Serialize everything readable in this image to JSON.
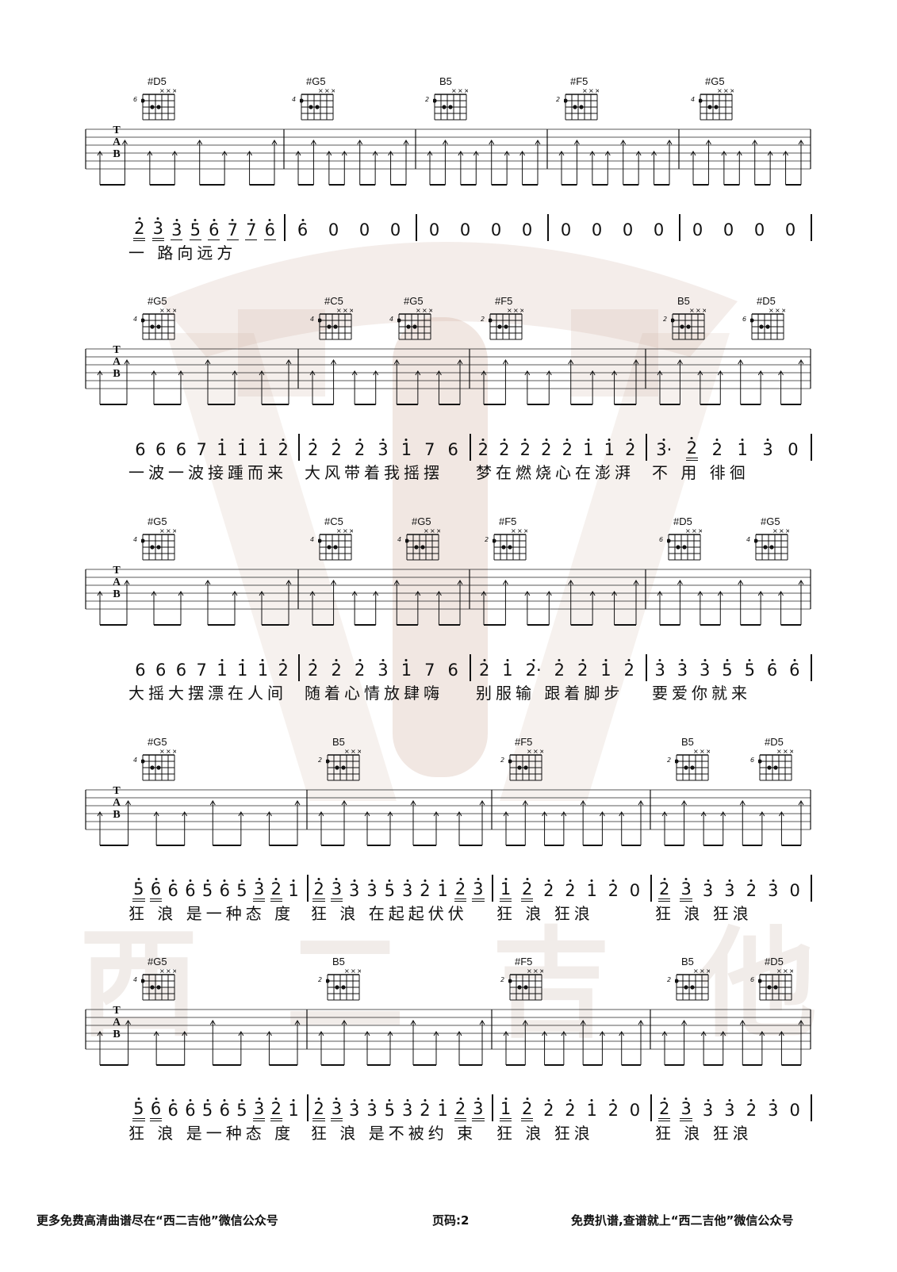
{
  "watermark": {
    "text": "西二吉他"
  },
  "systems": [
    {
      "chords": [
        {
          "name": "#D5",
          "fret": "6"
        },
        {
          "name": "#G5",
          "fret": "4"
        },
        {
          "name": "B5",
          "fret": "2"
        },
        {
          "name": "#F5",
          "fret": "2"
        },
        {
          "name": "#G5",
          "fret": "4"
        }
      ],
      "bars": [
        {
          "notes": [
            {
              "t": "2",
              "u": 2,
              "d": "hd"
            },
            {
              "t": "3",
              "u": 2,
              "d": "hd"
            },
            {
              "t": "3",
              "u": 1,
              "d": "hd"
            },
            {
              "t": "5",
              "u": 1,
              "d": "hd"
            },
            {
              "t": "6",
              "u": 1,
              "d": "hd"
            },
            {
              "t": "7",
              "u": 1,
              "d": "hd"
            },
            {
              "t": "7",
              "u": 1,
              "d": "hd"
            },
            {
              "t": "6",
              "u": 1,
              "d": "hd"
            }
          ]
        },
        {
          "notes": [
            {
              "t": "6",
              "u": 0,
              "d": "hd"
            },
            {
              "t": "0"
            },
            {
              "t": "0"
            },
            {
              "t": "0"
            }
          ]
        },
        {
          "notes": [
            {
              "t": "0"
            },
            {
              "t": "0"
            },
            {
              "t": "0"
            },
            {
              "t": "0"
            }
          ]
        },
        {
          "notes": [
            {
              "t": "0"
            },
            {
              "t": "0"
            },
            {
              "t": "0"
            },
            {
              "t": "0"
            }
          ]
        },
        {
          "notes": [
            {
              "t": "0"
            },
            {
              "t": "0"
            },
            {
              "t": "0"
            },
            {
              "t": "0"
            }
          ]
        }
      ],
      "lyrics": [
        "一 路向远方"
      ]
    },
    {
      "chords": [
        {
          "name": "#G5",
          "fret": "4"
        },
        {
          "name": "#C5",
          "fret": "4"
        },
        {
          "name": "#G5",
          "fret": "4"
        },
        {
          "name": "#F5",
          "fret": "2"
        },
        {
          "name": "B5",
          "fret": "2"
        },
        {
          "name": "#D5",
          "fret": "6"
        }
      ],
      "bars": [
        {
          "notes": [
            {
              "t": "6"
            },
            {
              "t": "6"
            },
            {
              "t": "6"
            },
            {
              "t": "7"
            },
            {
              "t": "1",
              "d": "hd"
            },
            {
              "t": "1",
              "d": "hd"
            },
            {
              "t": "1",
              "d": "hd"
            },
            {
              "t": "2",
              "d": "hd"
            }
          ]
        },
        {
          "notes": [
            {
              "t": "2",
              "d": "hd"
            },
            {
              "t": "2",
              "d": "hd"
            },
            {
              "t": "2",
              "d": "hd"
            },
            {
              "t": "3",
              "d": "hd"
            },
            {
              "t": "1",
              "d": "hd"
            },
            {
              "t": "7"
            },
            {
              "t": "6"
            }
          ]
        },
        {
          "notes": [
            {
              "t": "2",
              "d": "hd"
            },
            {
              "t": "2",
              "d": "hd"
            },
            {
              "t": "2",
              "d": "hd"
            },
            {
              "t": "2",
              "d": "hd"
            },
            {
              "t": "2",
              "d": "hd"
            },
            {
              "t": "1",
              "d": "hd"
            },
            {
              "t": "1",
              "d": "hd"
            },
            {
              "t": "2",
              "d": "hd"
            }
          ]
        },
        {
          "notes": [
            {
              "t": "3·",
              "d": "hd"
            },
            {
              "t": "2",
              "d": "hd",
              "u": 2
            },
            {
              "t": "2",
              "d": "hd"
            },
            {
              "t": "1",
              "d": "hd"
            },
            {
              "t": "3",
              "d": "hd"
            },
            {
              "t": "0"
            }
          ]
        }
      ],
      "lyrics": [
        "一波一波接踵而来",
        "大风带着我摇摆",
        "梦在燃烧心在澎湃",
        "不 用 徘徊"
      ]
    },
    {
      "chords": [
        {
          "name": "#G5",
          "fret": "4"
        },
        {
          "name": "#C5",
          "fret": "4"
        },
        {
          "name": "#G5",
          "fret": "4"
        },
        {
          "name": "#F5",
          "fret": "2"
        },
        {
          "name": "#D5",
          "fret": "6"
        },
        {
          "name": "#G5",
          "fret": "4"
        }
      ],
      "bars": [
        {
          "notes": [
            {
              "t": "6"
            },
            {
              "t": "6"
            },
            {
              "t": "6"
            },
            {
              "t": "7"
            },
            {
              "t": "1",
              "d": "hd"
            },
            {
              "t": "1",
              "d": "hd"
            },
            {
              "t": "1",
              "d": "hd"
            },
            {
              "t": "2",
              "d": "hd"
            }
          ]
        },
        {
          "notes": [
            {
              "t": "2",
              "d": "hd"
            },
            {
              "t": "2",
              "d": "hd"
            },
            {
              "t": "2",
              "d": "hd"
            },
            {
              "t": "3",
              "d": "hd"
            },
            {
              "t": "1",
              "d": "hd"
            },
            {
              "t": "7"
            },
            {
              "t": "6"
            }
          ]
        },
        {
          "notes": [
            {
              "t": "2",
              "d": "hd"
            },
            {
              "t": "1",
              "d": "hd"
            },
            {
              "t": "2·",
              "d": "hd"
            },
            {
              "t": "2",
              "d": "hd"
            },
            {
              "t": "2",
              "d": "hd"
            },
            {
              "t": "1",
              "d": "hd"
            },
            {
              "t": "2",
              "d": "hd"
            }
          ]
        },
        {
          "notes": [
            {
              "t": "3",
              "d": "hd"
            },
            {
              "t": "3",
              "d": "hd"
            },
            {
              "t": "3",
              "d": "hd"
            },
            {
              "t": "5",
              "d": "hd"
            },
            {
              "t": "5",
              "d": "hd"
            },
            {
              "t": "6",
              "d": "hd"
            },
            {
              "t": "6",
              "d": "hd"
            }
          ]
        }
      ],
      "lyrics": [
        "大摇大摆漂在人间",
        "随着心情放肆嗨",
        "别服输 跟着脚步",
        "要爱你就来"
      ]
    },
    {
      "chords": [
        {
          "name": "#G5",
          "fret": "4"
        },
        {
          "name": "B5",
          "fret": "2"
        },
        {
          "name": "#F5",
          "fret": "2"
        },
        {
          "name": "B5",
          "fret": "2"
        },
        {
          "name": "#D5",
          "fret": "6"
        }
      ],
      "bars": [
        {
          "notes": [
            {
              "t": "5",
              "d": "hd",
              "u": 2
            },
            {
              "t": "6",
              "d": "hd",
              "u": 2
            },
            {
              "t": "6",
              "d": "hd"
            },
            {
              "t": "6",
              "d": "hd"
            },
            {
              "t": "5",
              "d": "hd"
            },
            {
              "t": "6",
              "d": "hd"
            },
            {
              "t": "5",
              "d": "hd"
            },
            {
              "t": "3",
              "d": "hd",
              "u": 2
            },
            {
              "t": "2",
              "d": "hd",
              "u": 2
            },
            {
              "t": "1",
              "d": "hd"
            }
          ]
        },
        {
          "notes": [
            {
              "t": "2",
              "d": "hd",
              "u": 2
            },
            {
              "t": "3",
              "d": "hd",
              "u": 2
            },
            {
              "t": "3",
              "d": "hd"
            },
            {
              "t": "3",
              "d": "hd"
            },
            {
              "t": "5",
              "d": "hd"
            },
            {
              "t": "3",
              "d": "hd"
            },
            {
              "t": "2",
              "d": "hd"
            },
            {
              "t": "1",
              "d": "hd"
            },
            {
              "t": "2",
              "d": "hd",
              "u": 2
            },
            {
              "t": "3",
              "d": "hd",
              "u": 2
            }
          ]
        },
        {
          "notes": [
            {
              "t": "1",
              "d": "hd",
              "u": 2
            },
            {
              "t": "2",
              "d": "hd",
              "u": 2
            },
            {
              "t": "2",
              "d": "hd"
            },
            {
              "t": "2",
              "d": "hd"
            },
            {
              "t": "1",
              "d": "hd"
            },
            {
              "t": "2",
              "d": "hd"
            },
            {
              "t": "0"
            }
          ]
        },
        {
          "notes": [
            {
              "t": "2",
              "d": "hd",
              "u": 2
            },
            {
              "t": "3",
              "d": "hd",
              "u": 2
            },
            {
              "t": "3",
              "d": "hd"
            },
            {
              "t": "3",
              "d": "hd"
            },
            {
              "t": "2",
              "d": "hd"
            },
            {
              "t": "3",
              "d": "hd"
            },
            {
              "t": "0"
            }
          ]
        }
      ],
      "lyrics": [
        "狂 浪  是一种态 度",
        "狂 浪  在起起伏伏",
        "狂 浪  狂浪",
        "狂 浪  狂浪"
      ]
    },
    {
      "chords": [
        {
          "name": "#G5",
          "fret": "4"
        },
        {
          "name": "B5",
          "fret": "2"
        },
        {
          "name": "#F5",
          "fret": "2"
        },
        {
          "name": "B5",
          "fret": "2"
        },
        {
          "name": "#D5",
          "fret": "6"
        }
      ],
      "bars": [
        {
          "notes": [
            {
              "t": "5",
              "d": "hd",
              "u": 2
            },
            {
              "t": "6",
              "d": "hd",
              "u": 2
            },
            {
              "t": "6",
              "d": "hd"
            },
            {
              "t": "6",
              "d": "hd"
            },
            {
              "t": "5",
              "d": "hd"
            },
            {
              "t": "6",
              "d": "hd"
            },
            {
              "t": "5",
              "d": "hd"
            },
            {
              "t": "3",
              "d": "hd",
              "u": 2
            },
            {
              "t": "2",
              "d": "hd",
              "u": 2
            },
            {
              "t": "1",
              "d": "hd"
            }
          ]
        },
        {
          "notes": [
            {
              "t": "2",
              "d": "hd",
              "u": 2
            },
            {
              "t": "3",
              "d": "hd",
              "u": 2
            },
            {
              "t": "3",
              "d": "hd"
            },
            {
              "t": "3",
              "d": "hd"
            },
            {
              "t": "5",
              "d": "hd"
            },
            {
              "t": "3",
              "d": "hd"
            },
            {
              "t": "2",
              "d": "hd"
            },
            {
              "t": "1",
              "d": "hd"
            },
            {
              "t": "2",
              "d": "hd",
              "u": 2
            },
            {
              "t": "3",
              "d": "hd",
              "u": 2
            }
          ]
        },
        {
          "notes": [
            {
              "t": "1",
              "d": "hd",
              "u": 2
            },
            {
              "t": "2",
              "d": "hd",
              "u": 2
            },
            {
              "t": "2",
              "d": "hd"
            },
            {
              "t": "2",
              "d": "hd"
            },
            {
              "t": "1",
              "d": "hd"
            },
            {
              "t": "2",
              "d": "hd"
            },
            {
              "t": "0"
            }
          ]
        },
        {
          "notes": [
            {
              "t": "2",
              "d": "hd",
              "u": 2
            },
            {
              "t": "3",
              "d": "hd",
              "u": 2
            },
            {
              "t": "3",
              "d": "hd"
            },
            {
              "t": "3",
              "d": "hd"
            },
            {
              "t": "2",
              "d": "hd"
            },
            {
              "t": "3",
              "d": "hd"
            },
            {
              "t": "0"
            }
          ]
        }
      ],
      "lyrics": [
        "狂 浪  是一种态 度",
        "狂 浪  是不被约 束",
        "狂 浪  狂浪",
        "狂 浪  狂浪"
      ]
    }
  ],
  "footer": {
    "left": "更多免费高清曲谱尽在“西二吉他”微信公众号",
    "center": "页码:2",
    "right": "免费扒谱,查谱就上“西二吉他”微信公众号"
  }
}
